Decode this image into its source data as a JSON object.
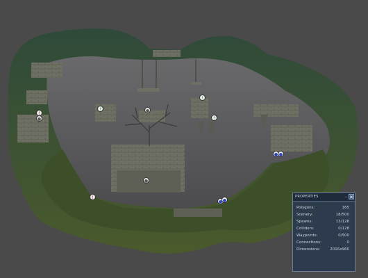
{
  "properties_panel": {
    "title": "Properties",
    "rows": [
      {
        "label": "Polygons:",
        "value": "165"
      },
      {
        "label": "Scenery:",
        "value": "18/500"
      },
      {
        "label": "Spawns:",
        "value": "13/128"
      },
      {
        "label": "Colliders:",
        "value": "0/128"
      },
      {
        "label": "Waypoints:",
        "value": "0/500"
      },
      {
        "label": "Connections:",
        "value": "0"
      },
      {
        "label": "Dimensions:",
        "value": "2016x960"
      }
    ]
  },
  "colors": {
    "background": "#4a4a4a",
    "cave_interior": "#5a5a5c",
    "grass": "#3f5a2e",
    "stone": "#6d6e63",
    "panel": "#2b3a4e"
  },
  "markers": [
    {
      "type": "spawn",
      "color": "red"
    },
    {
      "type": "spawn",
      "color": "gray"
    },
    {
      "type": "spawn",
      "color": "green"
    },
    {
      "type": "spawn",
      "color": "gray"
    },
    {
      "type": "spawn",
      "color": "green"
    },
    {
      "type": "spawn",
      "color": "green"
    },
    {
      "type": "spawn",
      "color": "blue"
    },
    {
      "type": "spawn",
      "color": "blue"
    },
    {
      "type": "spawn",
      "color": "gray"
    },
    {
      "type": "spawn",
      "color": "red"
    },
    {
      "type": "spawn",
      "color": "blue"
    },
    {
      "type": "spawn",
      "color": "blue"
    }
  ]
}
